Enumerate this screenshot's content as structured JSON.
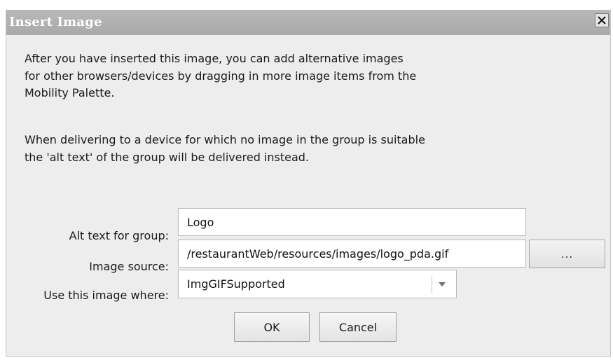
{
  "window": {
    "title": "Insert Image",
    "close_icon": "close-x-icon"
  },
  "message": {
    "paragraph1": "After you have inserted this image, you can add alternative images\nfor other browsers/devices by dragging in more image items from the\nMobility Palette.",
    "paragraph2": "When delivering to a device for which no image in the group is suitable\nthe 'alt text' of the group will be delivered instead."
  },
  "form": {
    "alt_text_label": "Alt text for group:",
    "alt_text_value": "Logo",
    "image_source_label": "Image source:",
    "image_source_value": "/restaurantWeb/resources/images/logo_pda.gif",
    "browse_label": "...",
    "use_where_label": "Use this image where:",
    "use_where_value": "ImgGIFSupported",
    "dropdown_icon": "chevron-down-icon"
  },
  "buttons": {
    "ok_label": "OK",
    "cancel_label": "Cancel"
  }
}
